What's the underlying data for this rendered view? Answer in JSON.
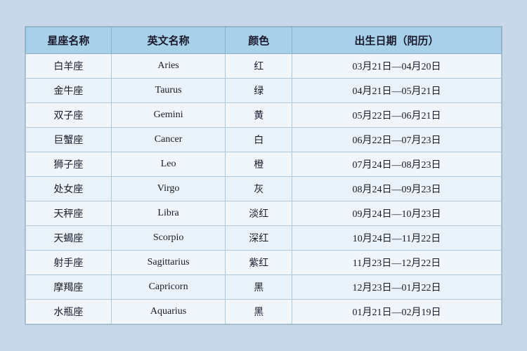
{
  "table": {
    "headers": {
      "chinese_name": "星座名称",
      "english_name": "英文名称",
      "color": "颜色",
      "birthdate": "出生日期（阳历）"
    },
    "rows": [
      {
        "chinese": "白羊座",
        "english": "Aries",
        "color": "红",
        "date": "03月21日—04月20日"
      },
      {
        "chinese": "金牛座",
        "english": "Taurus",
        "color": "绿",
        "date": "04月21日—05月21日"
      },
      {
        "chinese": "双子座",
        "english": "Gemini",
        "color": "黄",
        "date": "05月22日—06月21日"
      },
      {
        "chinese": "巨蟹座",
        "english": "Cancer",
        "color": "白",
        "date": "06月22日—07月23日"
      },
      {
        "chinese": "狮子座",
        "english": "Leo",
        "color": "橙",
        "date": "07月24日—08月23日"
      },
      {
        "chinese": "处女座",
        "english": "Virgo",
        "color": "灰",
        "date": "08月24日—09月23日"
      },
      {
        "chinese": "天秤座",
        "english": "Libra",
        "color": "淡红",
        "date": "09月24日—10月23日"
      },
      {
        "chinese": "天蝎座",
        "english": "Scorpio",
        "color": "深红",
        "date": "10月24日—11月22日"
      },
      {
        "chinese": "射手座",
        "english": "Sagittarius",
        "color": "紫红",
        "date": "11月23日—12月22日"
      },
      {
        "chinese": "摩羯座",
        "english": "Capricorn",
        "color": "黑",
        "date": "12月23日—01月22日"
      },
      {
        "chinese": "水瓶座",
        "english": "Aquarius",
        "color": "黑",
        "date": "01月21日—02月19日"
      }
    ]
  }
}
